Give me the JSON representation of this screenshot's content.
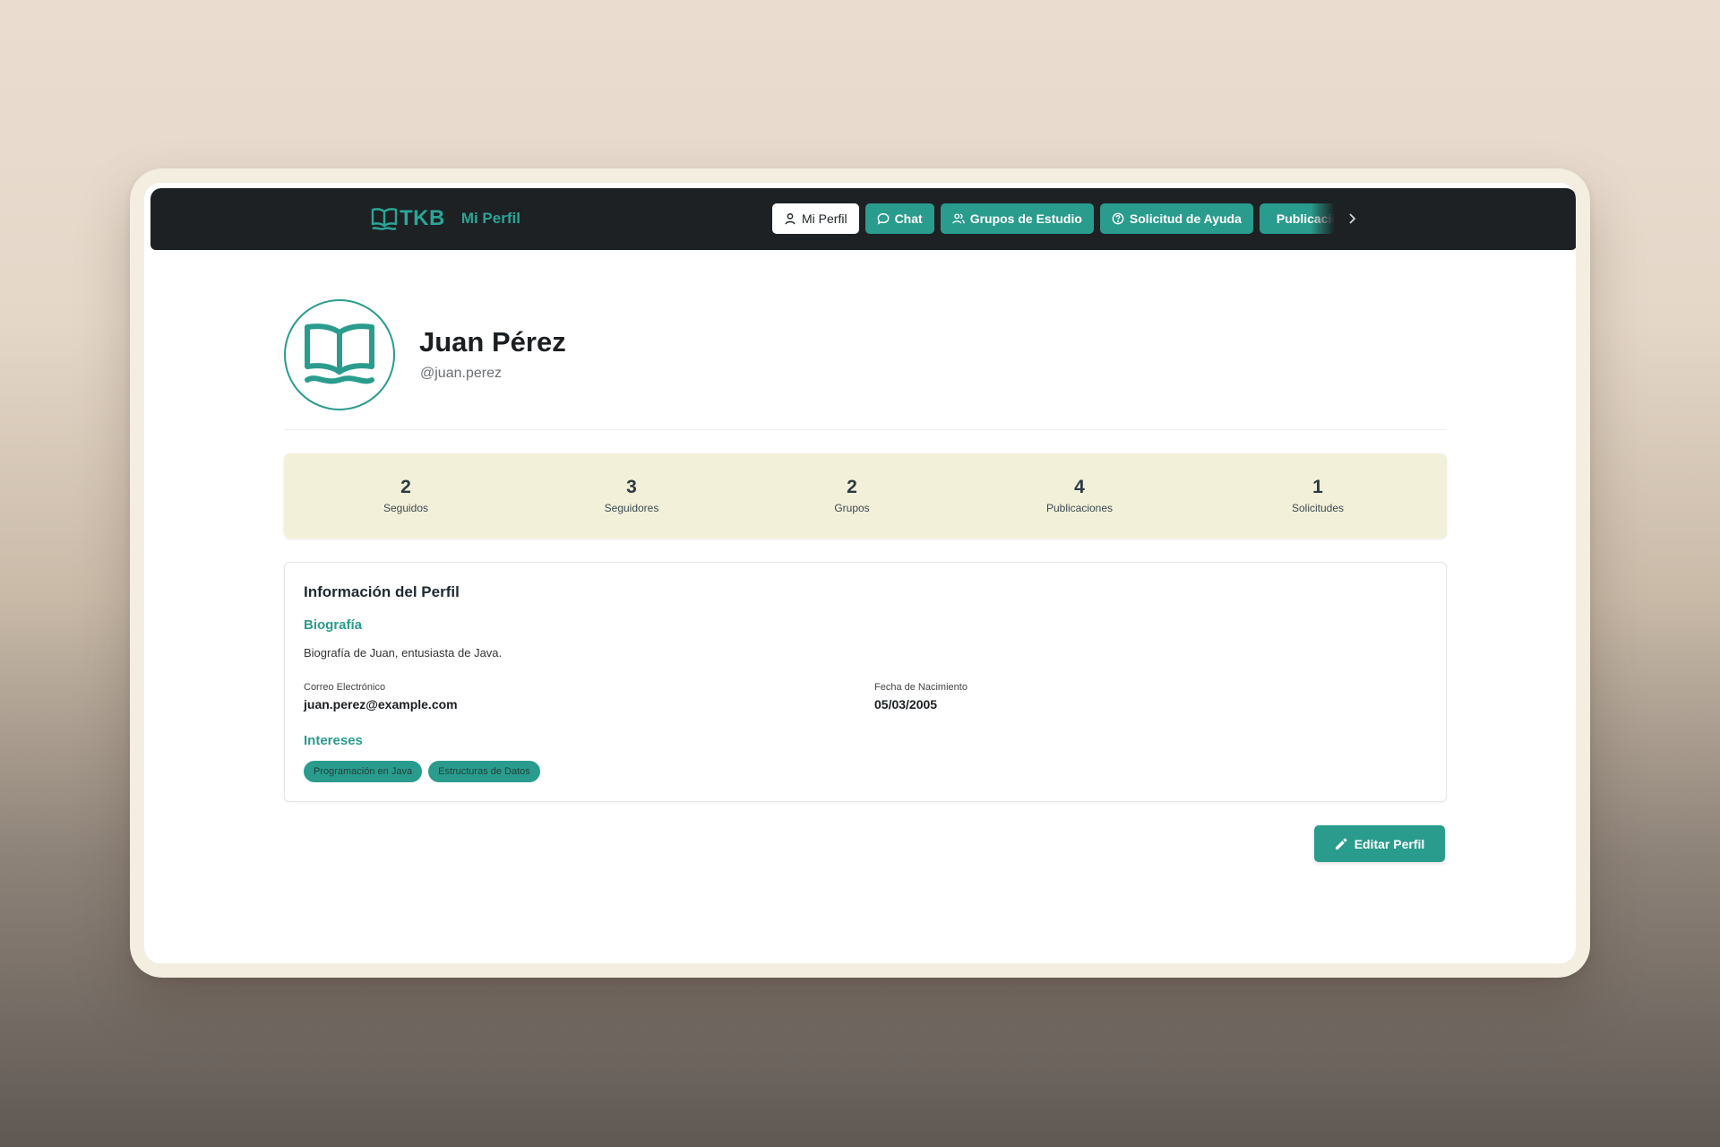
{
  "header": {
    "brand": "TKB",
    "page_title": "Mi Perfil",
    "nav": [
      {
        "label": "Mi Perfil",
        "icon": "user-icon",
        "active": true
      },
      {
        "label": "Chat",
        "icon": "chat-bubble-icon"
      },
      {
        "label": "Grupos de Estudio",
        "icon": "users-icon"
      },
      {
        "label": "Solicitud de Ayuda",
        "icon": "help-circle-icon"
      },
      {
        "label": "Publicaciones",
        "icon": "document-icon"
      }
    ]
  },
  "profile": {
    "name": "Juan Pérez",
    "handle": "@juan.perez",
    "avatar_icon": "open-book-icon"
  },
  "stats": [
    {
      "value": "2",
      "label": "Seguidos"
    },
    {
      "value": "3",
      "label": "Seguidores"
    },
    {
      "value": "2",
      "label": "Grupos"
    },
    {
      "value": "4",
      "label": "Publicaciones"
    },
    {
      "value": "1",
      "label": "Solicitudes"
    }
  ],
  "info": {
    "title": "Información del Perfil",
    "bio_title": "Biografía",
    "bio": "Biografía de Juan, entusiasta de Java.",
    "email_label": "Correo Electrónico",
    "email": "juan.perez@example.com",
    "birth_label": "Fecha de Nacimiento",
    "birth": "05/03/2005",
    "interests_title": "Intereses",
    "interests": [
      "Programación en Java",
      "Estructuras de Datos"
    ]
  },
  "actions": {
    "edit_label": "Editar Perfil"
  },
  "colors": {
    "accent": "#2a9c8d",
    "navbar": "#1d2124",
    "stats_bg": "#f2f0d9"
  }
}
